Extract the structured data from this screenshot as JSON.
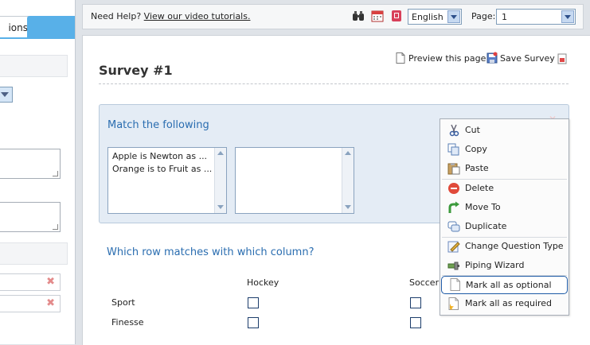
{
  "left_panel": {
    "tab_label": "ions"
  },
  "toolbar": {
    "help_prefix": "Need Help?",
    "help_link": "View our video tutorials.",
    "language_value": "English",
    "page_label": "Page:",
    "page_value": "1"
  },
  "survey": {
    "title": "Survey #1",
    "preview_label": "Preview this page",
    "save_label": "Save Survey"
  },
  "question": {
    "title": "Match the following",
    "left_items": [
      "Apple is Newton as ...",
      "Orange is to Fruit as ..."
    ]
  },
  "matrix": {
    "title": "Which row matches with which column?",
    "columns": [
      "Hockey",
      "Soccer"
    ],
    "rows": [
      "Sport",
      "Finesse"
    ]
  },
  "context_menu": {
    "items": [
      {
        "label": "Cut",
        "icon": "scissors-icon"
      },
      {
        "label": "Copy",
        "icon": "copy-icon"
      },
      {
        "label": "Paste",
        "icon": "paste-icon"
      },
      {
        "label": "Delete",
        "icon": "delete-icon"
      },
      {
        "label": "Move To",
        "icon": "move-icon"
      },
      {
        "label": "Duplicate",
        "icon": "duplicate-icon"
      },
      {
        "label": "Change Question Type",
        "icon": "edit-icon"
      },
      {
        "label": "Piping Wizard",
        "icon": "piping-icon"
      },
      {
        "label": "Mark all as optional",
        "icon": "optional-icon"
      },
      {
        "label": "Mark all as required",
        "icon": "required-icon"
      }
    ]
  },
  "colors": {
    "accent": "#58b0e8",
    "question_title": "#2a6db0",
    "question_bg": "#e4ecf5",
    "highlight_border": "#1d5aa6"
  }
}
